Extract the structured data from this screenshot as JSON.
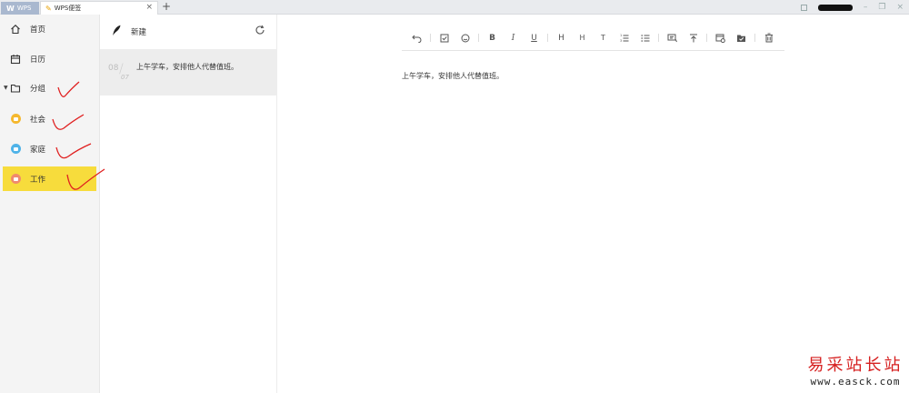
{
  "tabs": {
    "wps_label": "WPS",
    "note_label": "WPS便签"
  },
  "sidebar": {
    "items": [
      {
        "label": "首页",
        "icon": "home-icon"
      },
      {
        "label": "日历",
        "icon": "calendar-icon"
      },
      {
        "label": "分组",
        "icon": "folder-outline-icon"
      },
      {
        "label": "社会",
        "icon": "folder-icon",
        "color": "#f5b82e"
      },
      {
        "label": "家庭",
        "icon": "folder-icon",
        "color": "#4fb3e8"
      },
      {
        "label": "工作",
        "icon": "folder-icon",
        "color": "#f08a6d"
      }
    ],
    "active_color": "#f7dc3c"
  },
  "notelist": {
    "new_label": "新建",
    "notes": [
      {
        "day": "08",
        "month": "07",
        "text": "上午学车，安排他人代替值班。"
      }
    ]
  },
  "editor": {
    "content": "上午学车，安排他人代替值班。"
  },
  "watermark": {
    "text": "易采站长站",
    "url": "www.easck.com",
    "color": "#d62020"
  }
}
